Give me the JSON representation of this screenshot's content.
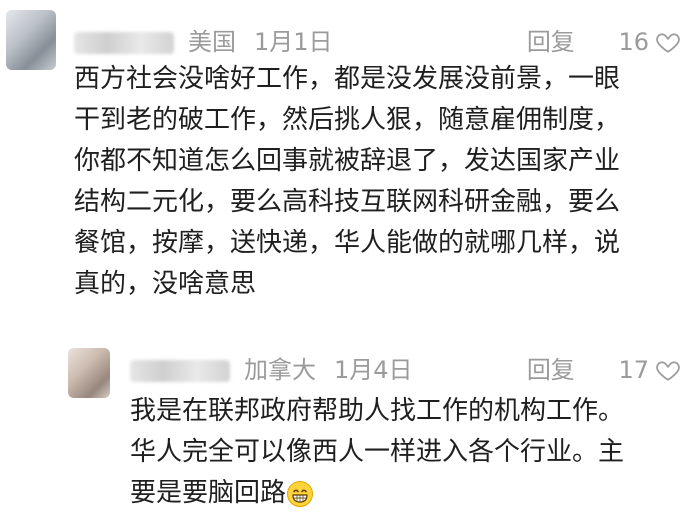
{
  "comments": [
    {
      "location": "美国",
      "date": "1月1日",
      "reply_label": "回复",
      "like_count": "16",
      "lines": [
        "西方社会没啥好工作，都是没发展没前景，一眼",
        "干到老的破工作，然后挑人狠，随意雇佣制度，",
        "你都不知道怎么回事就被辞退了，发达国家产业",
        "结构二元化，要么高科技互联网科研金融，要么",
        "餐馆，按摩，送快递，华人能做的就哪几样，说",
        "真的，没啥意思"
      ]
    },
    {
      "location": "加拿大",
      "date": "1月4日",
      "reply_label": "回复",
      "like_count": "17",
      "lines": [
        "我是在联邦政府帮助人找工作的机构工作。",
        "华人完全可以像西人一样进入各个行业。主",
        "要是要脑回路"
      ],
      "trailing_emoji": "grinning-emoji"
    }
  ],
  "icons": {
    "like": "heart-outline-icon"
  },
  "colors": {
    "meta_text": "#9b9b9b",
    "body_text": "#1f1f1f",
    "background": "#ffffff"
  }
}
